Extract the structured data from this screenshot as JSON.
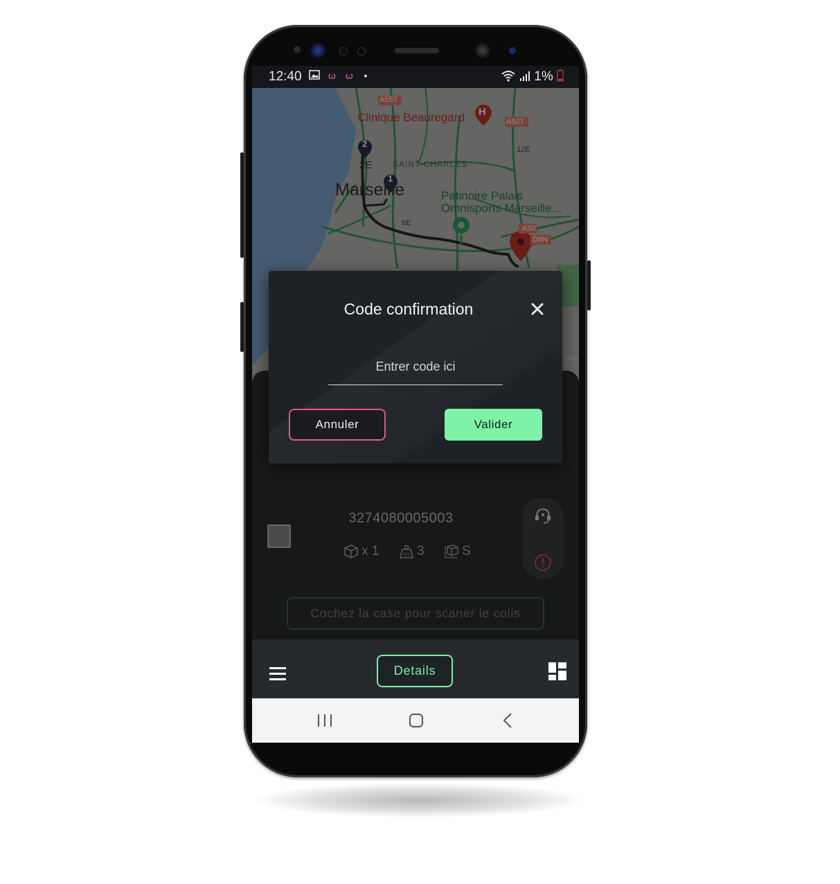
{
  "status_bar": {
    "time": "12:40",
    "battery": "1%"
  },
  "map": {
    "labels": {
      "hospital": "Clinique Beauregard",
      "district": "SAINT-CHARLES",
      "city": "Marseille",
      "venue_line1": "Patinoire Palais",
      "venue_line2": "Omnisports Marseille...",
      "road_a557": "A557",
      "road_a507": "A507",
      "road_a50": "A50",
      "road_d8n": "D8N",
      "arr_12e": "12E",
      "arr_2e": "2E",
      "arr_6e": "6E",
      "edge_text": "AUI"
    },
    "markers": {
      "stop_1": "1",
      "stop_2": "2"
    }
  },
  "modal": {
    "title": "Code confirmation",
    "code_placeholder": "Entrer code ici",
    "cancel_label": "Annuler",
    "validate_label": "Valider"
  },
  "parcel": {
    "barcode": "3274080005003",
    "quantity": "x 1",
    "weight": "3",
    "size": "S"
  },
  "scan_button_label": "Cochez la case pour scaner le colis",
  "bottom_bar": {
    "details_label": "Details"
  },
  "colors": {
    "accent_green": "#7df0a8",
    "cancel_red": "#e05b7a"
  }
}
